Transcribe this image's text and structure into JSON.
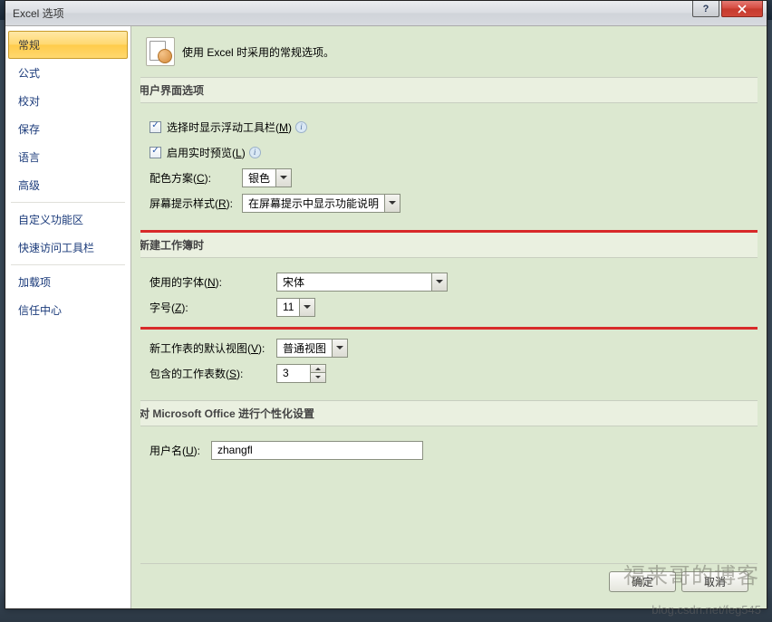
{
  "window": {
    "title": "Excel 选项"
  },
  "sidebar": {
    "items": [
      {
        "label": "常规",
        "active": true
      },
      {
        "label": "公式"
      },
      {
        "label": "校对"
      },
      {
        "label": "保存"
      },
      {
        "label": "语言"
      },
      {
        "label": "高级"
      },
      {
        "sep": true
      },
      {
        "label": "自定义功能区"
      },
      {
        "label": "快速访问工具栏"
      },
      {
        "sep": true
      },
      {
        "label": "加载项"
      },
      {
        "label": "信任中心"
      }
    ]
  },
  "intro": {
    "text": "使用 Excel 时采用的常规选项。"
  },
  "sections": {
    "ui": {
      "title": "用户界面选项",
      "showMiniToolbar": {
        "label_pre": "选择时显示浮动工具栏(",
        "accel": "M",
        "label_post": ")",
        "checked": true
      },
      "livePreview": {
        "label_pre": "启用实时预览(",
        "accel": "L",
        "label_post": ")",
        "checked": true
      },
      "colorScheme": {
        "label_pre": "配色方案(",
        "accel": "C",
        "label_post": "):",
        "value": "银色"
      },
      "screentip": {
        "label_pre": "屏幕提示样式(",
        "accel": "R",
        "label_post": "):",
        "value": "在屏幕提示中显示功能说明"
      }
    },
    "newbook": {
      "title": "新建工作簿时",
      "font": {
        "label_pre": "使用的字体(",
        "accel": "N",
        "label_post": "):",
        "value": "宋体"
      },
      "size": {
        "label_pre": "字号(",
        "accel": "Z",
        "label_post": "):",
        "value": "11"
      },
      "view": {
        "label_pre": "新工作表的默认视图(",
        "accel": "V",
        "label_post": "):",
        "value": "普通视图"
      },
      "sheets": {
        "label_pre": "包含的工作表数(",
        "accel": "S",
        "label_post": "):",
        "value": "3"
      }
    },
    "personal": {
      "title": "对 Microsoft Office 进行个性化设置",
      "username": {
        "label_pre": "用户名(",
        "accel": "U",
        "label_post": "):",
        "value": "zhangfl"
      }
    }
  },
  "footer": {
    "ok": "确定",
    "cancel": "取消"
  },
  "watermark": {
    "line1": "福来哥的博客",
    "line2": "blog.csdn.net/feg545"
  }
}
